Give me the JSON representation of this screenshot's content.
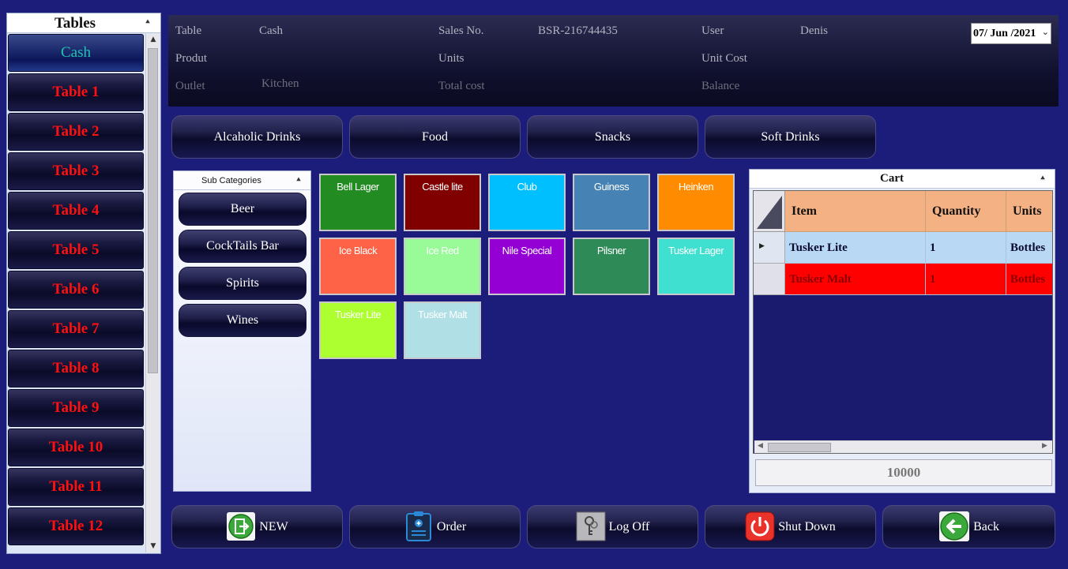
{
  "tables_panel": {
    "title": "Tables",
    "items": [
      {
        "label": "Cash",
        "selected": true
      },
      {
        "label": "Table 1"
      },
      {
        "label": "Table 2"
      },
      {
        "label": "Table 3"
      },
      {
        "label": "Table 4"
      },
      {
        "label": "Table 5"
      },
      {
        "label": "Table 6"
      },
      {
        "label": "Table 7"
      },
      {
        "label": "Table 8"
      },
      {
        "label": "Table 9"
      },
      {
        "label": "Table 10"
      },
      {
        "label": "Table 11"
      },
      {
        "label": "Table 12"
      }
    ]
  },
  "info": {
    "table_label": "Table",
    "table_value": "Cash",
    "sales_label": "Sales No.",
    "sales_value": "BSR-216744435",
    "user_label": "User",
    "user_value": "Denis",
    "product_label": "Produt",
    "units_label": "Units",
    "unit_cost_label": "Unit Cost",
    "outlet_label": "Outlet",
    "outlet_value": "Kitchen",
    "total_cost_label": "Total cost",
    "balance_label": "Balance",
    "date_value": "07/ Jun /2021"
  },
  "categories": [
    "Alcaholic Drinks",
    "Food",
    "Snacks",
    "Soft Drinks"
  ],
  "sub_categories": {
    "title": "Sub Categories",
    "items": [
      "Beer",
      "CockTails Bar",
      "Spirits",
      "Wines"
    ]
  },
  "products": [
    {
      "name": "Bell Lager",
      "color": "#228b22"
    },
    {
      "name": "Castle lite",
      "color": "#800000"
    },
    {
      "name": "Club",
      "color": "#00bfff"
    },
    {
      "name": "Guiness",
      "color": "#4682b4"
    },
    {
      "name": "Heinken",
      "color": "#ff8c00"
    },
    {
      "name": "Ice Black",
      "color": "#ff6347"
    },
    {
      "name": "Ice Red",
      "color": "#98fb98"
    },
    {
      "name": "Nile Special",
      "color": "#9400d3"
    },
    {
      "name": "Pilsner",
      "color": "#2e8b57"
    },
    {
      "name": "Tusker Lager",
      "color": "#40e0d0"
    },
    {
      "name": "Tusker Lite",
      "color": "#adff2f"
    },
    {
      "name": "Tusker Malt",
      "color": "#b0e0e6"
    }
  ],
  "cart": {
    "title": "Cart",
    "columns": [
      "Item",
      "Quantity",
      "Units"
    ],
    "rows": [
      {
        "item": "Tusker Lite",
        "quantity": "1",
        "units": "Bottles"
      },
      {
        "item": "Tusker Malt",
        "quantity": "1",
        "units": "Bottles"
      }
    ],
    "total": "10000"
  },
  "actions": [
    {
      "label": "NEW",
      "icon": "exit-door-icon"
    },
    {
      "label": "Order",
      "icon": "clipboard-icon"
    },
    {
      "label": "Log Off",
      "icon": "keys-icon"
    },
    {
      "label": "Shut Down",
      "icon": "power-icon"
    },
    {
      "label": "Back",
      "icon": "back-arrow-icon"
    }
  ]
}
